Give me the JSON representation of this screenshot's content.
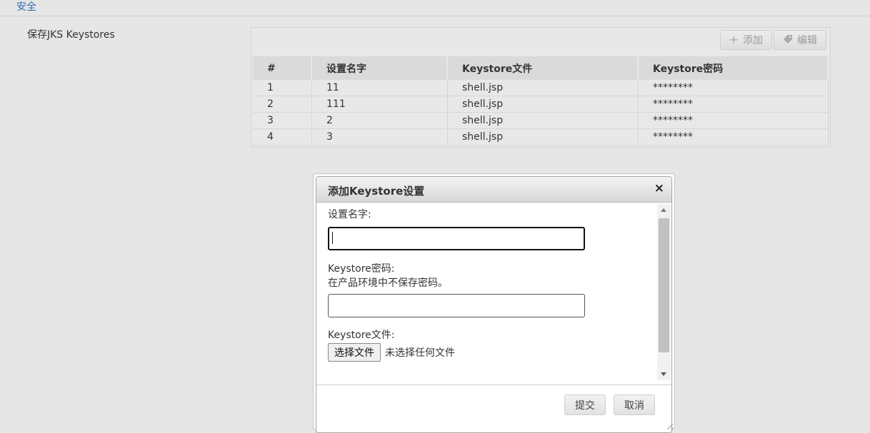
{
  "section": {
    "title": "安全"
  },
  "keystores": {
    "label": "保存JKS Keystores",
    "toolbar": {
      "add_label": "添加",
      "edit_label": "编辑"
    },
    "columns": [
      "#",
      "设置名字",
      "Keystore文件",
      "Keystore密码"
    ],
    "rows": [
      [
        "1",
        "11",
        "shell.jsp",
        "********"
      ],
      [
        "2",
        "111",
        "shell.jsp",
        "********"
      ],
      [
        "3",
        "2",
        "shell.jsp",
        "********"
      ],
      [
        "4",
        "3",
        "shell.jsp",
        "********"
      ]
    ]
  },
  "dialog": {
    "title": "添加Keystore设置",
    "close_icon": "×",
    "name_label": "设置名字:",
    "name_value": "",
    "password_label": "Keystore密码:",
    "password_note": "在产品环境中不保存密码。",
    "password_value": "",
    "file_label": "Keystore文件:",
    "file_button": "选择文件",
    "file_status": "未选择任何文件",
    "submit_label": "提交",
    "cancel_label": "取消"
  }
}
